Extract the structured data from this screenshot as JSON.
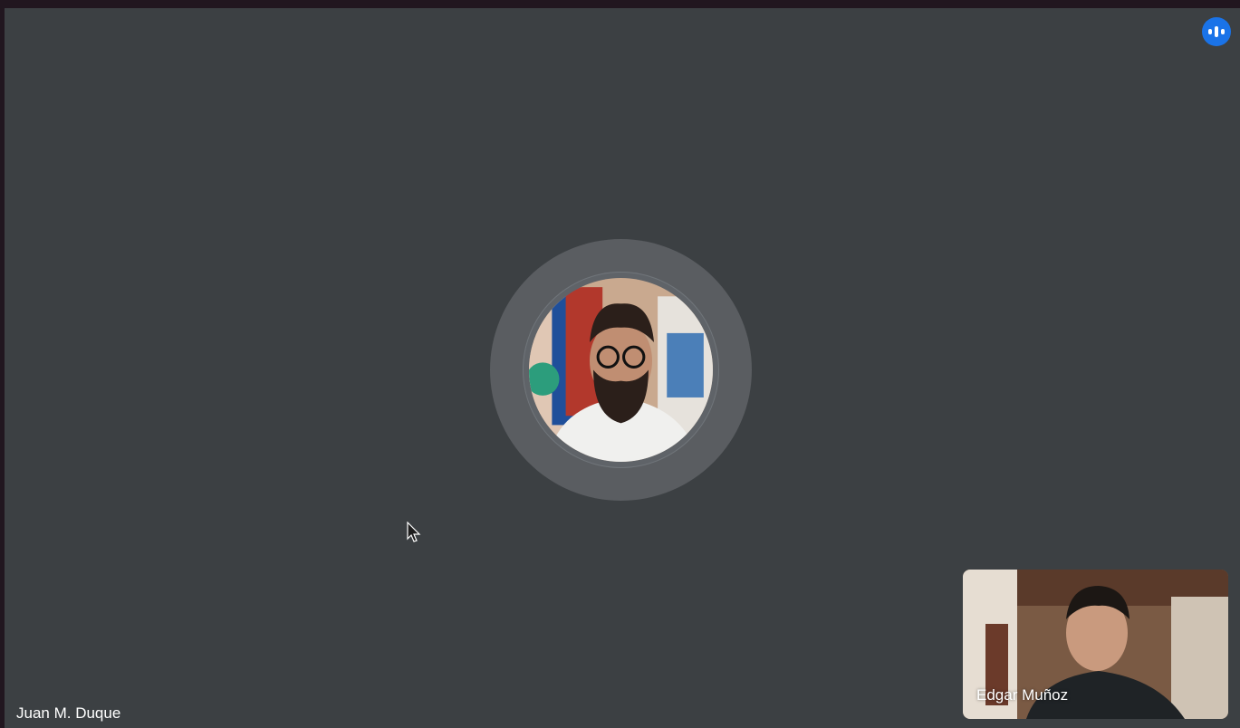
{
  "main_participant": {
    "name": "Juan M. Duque"
  },
  "self_view": {
    "name": "Edgar Muñoz"
  },
  "indicators": {
    "speaking_icon": "audio-level-icon"
  },
  "colors": {
    "stage_background": "#3c4043",
    "speaking_badge": "#1a73e8",
    "halo": "#5a5d61"
  }
}
